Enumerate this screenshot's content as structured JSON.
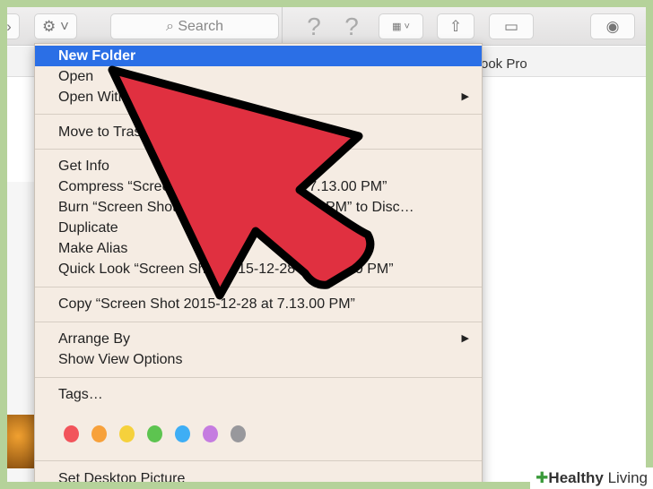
{
  "toolbar": {
    "search_placeholder": "Search",
    "help1": "?",
    "help2": "?"
  },
  "path_text": "ook Pro",
  "menu": {
    "items": [
      {
        "label": "New Folder"
      },
      {
        "label": "Open"
      },
      {
        "label": "Open With"
      },
      {
        "label": "Move to Trash"
      },
      {
        "label": "Get Info"
      },
      {
        "label": "Compress “Screen Shot 2015-12-28 at 7.13.00 PM”"
      },
      {
        "label": "Burn “Screen Shot 2015-12-28 at 7.13.00 PM” to Disc…"
      },
      {
        "label": "Duplicate"
      },
      {
        "label": "Make Alias"
      },
      {
        "label": "Quick Look “Screen Shot 2015-12-28 at 7.13.00 PM”"
      },
      {
        "label": "Copy “Screen Shot 2015-12-28 at 7.13.00 PM”"
      },
      {
        "label": "Arrange By"
      },
      {
        "label": "Show View Options"
      },
      {
        "label": "Tags…"
      },
      {
        "label": "Set Desktop Picture"
      }
    ],
    "tag_colors": [
      "#f2545b",
      "#f7a13b",
      "#f5d13c",
      "#5dc450",
      "#3eaef5",
      "#c57ce0",
      "#98989c"
    ]
  },
  "watermark": {
    "brand": "Healthy",
    "suffix": "Living"
  }
}
